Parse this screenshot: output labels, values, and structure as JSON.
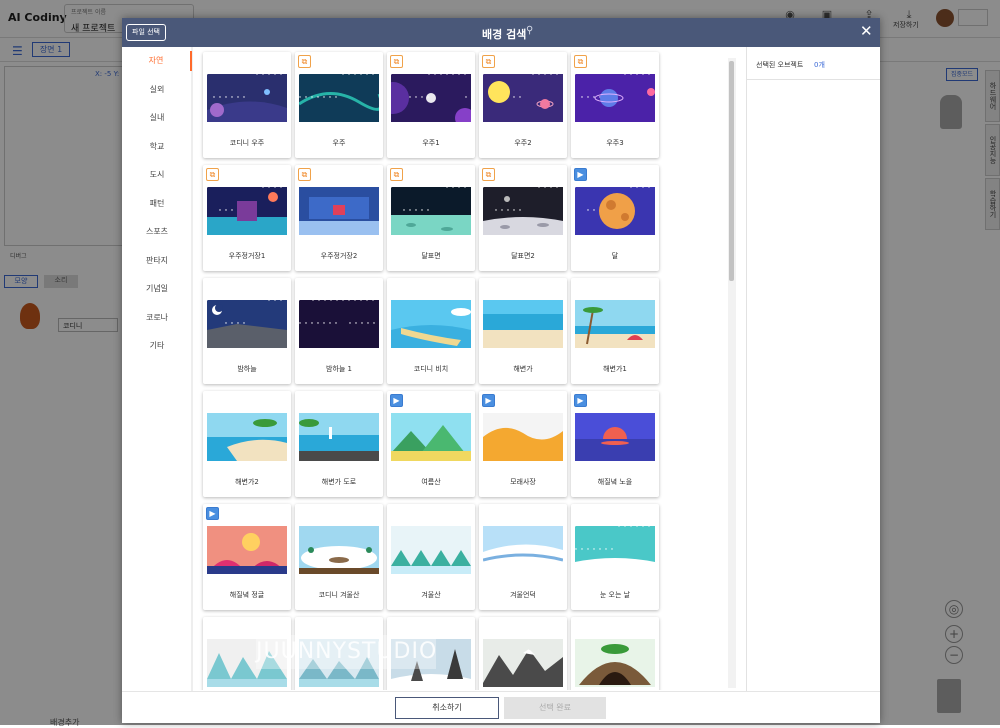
{
  "app": {
    "logo": "AI Codiny",
    "project_label": "프로젝트 이름",
    "project_name": "새 프로젝트",
    "save_label": "저장하기",
    "scene_tab": "장면 1",
    "coord": "X: -5 Y:",
    "debug": "디버그",
    "tab_shape": "모양",
    "tab_sound": "소리",
    "char_name": "코디니",
    "focus_mode": "집중모드",
    "side_tabs": [
      "하드웨어",
      "인공지능",
      "학습하기"
    ],
    "bottom_tab": "배경추가"
  },
  "modal": {
    "file_button": "파일 선택",
    "title": "배경 검색",
    "categories": [
      "자연",
      "실외",
      "실내",
      "학교",
      "도시",
      "패턴",
      "스포츠",
      "판타지",
      "기념일",
      "코로나",
      "기타"
    ],
    "active_category": "자연",
    "selected_label": "선택된 오브젝트",
    "selected_count": "0개",
    "cancel": "취소하기",
    "done": "선택 완료",
    "cards": [
      {
        "label": "코디니 우주",
        "badge": "",
        "scene": "space-blue"
      },
      {
        "label": "우주",
        "badge": "image",
        "scene": "space-teal"
      },
      {
        "label": "우주1",
        "badge": "image",
        "scene": "space-purple"
      },
      {
        "label": "우주2",
        "badge": "image",
        "scene": "space-planets"
      },
      {
        "label": "우주3",
        "badge": "image",
        "scene": "space-violet"
      },
      {
        "label": "우주정거장1",
        "badge": "image",
        "scene": "station1"
      },
      {
        "label": "우주정거장2",
        "badge": "image",
        "scene": "station2"
      },
      {
        "label": "달표면",
        "badge": "image",
        "scene": "moon-surface"
      },
      {
        "label": "달표면2",
        "badge": "image",
        "scene": "moon-surface2"
      },
      {
        "label": "달",
        "badge": "video",
        "scene": "moon"
      },
      {
        "label": "밤하늘",
        "badge": "",
        "scene": "night-moon"
      },
      {
        "label": "밤하늘 1",
        "badge": "",
        "scene": "night-stars"
      },
      {
        "label": "코디니 비치",
        "badge": "",
        "scene": "beach"
      },
      {
        "label": "해변가",
        "badge": "",
        "scene": "beach-plain"
      },
      {
        "label": "해변가1",
        "badge": "",
        "scene": "beach-palm"
      },
      {
        "label": "해변가2",
        "badge": "",
        "scene": "beach2"
      },
      {
        "label": "해변가 도로",
        "badge": "",
        "scene": "beach-road"
      },
      {
        "label": "여름산",
        "badge": "video",
        "scene": "summer-mountain"
      },
      {
        "label": "모래사장",
        "badge": "video",
        "scene": "sand"
      },
      {
        "label": "해질녘 노을",
        "badge": "video",
        "scene": "sunset"
      },
      {
        "label": "해질녘 정글",
        "badge": "video",
        "scene": "jungle"
      },
      {
        "label": "코디니 겨울산",
        "badge": "",
        "scene": "winter-island"
      },
      {
        "label": "겨울산",
        "badge": "",
        "scene": "winter-mountain"
      },
      {
        "label": "겨울언덕",
        "badge": "",
        "scene": "winter-hill"
      },
      {
        "label": "눈 오는 날",
        "badge": "",
        "scene": "snow-day"
      },
      {
        "label": "",
        "badge": "",
        "scene": "ice-mountain"
      },
      {
        "label": "",
        "badge": "",
        "scene": "ice-mountain2"
      },
      {
        "label": "",
        "badge": "",
        "scene": "snow-trees"
      },
      {
        "label": "",
        "badge": "",
        "scene": "rocky"
      },
      {
        "label": "",
        "badge": "",
        "scene": "cave"
      }
    ]
  },
  "watermark": "JUUNNYSTUDIO",
  "colors": {
    "header": "#4a5879",
    "accent": "#ff6a2b",
    "link": "#3c6ad6"
  }
}
